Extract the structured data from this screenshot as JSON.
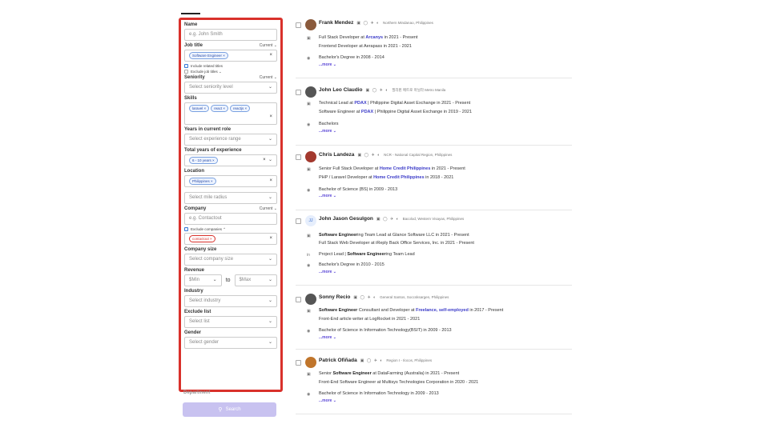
{
  "filters": {
    "name_label": "Name",
    "name_placeholder": "e.g. John Smith",
    "job_title_label": "Job title",
    "job_title_mode": "Current",
    "job_title_chip": "Software Engineer ×",
    "include_related": "Include related titles",
    "exclude_titles": "Exclude job titles ⌄",
    "seniority_label": "Seniority",
    "seniority_mode": "Current",
    "seniority_placeholder": "Select seniority level",
    "skills_label": "Skills",
    "skill_chips": [
      "laravel ×",
      "react ×",
      "reactjs ×"
    ],
    "years_role_label": "Years in current role",
    "years_role_placeholder": "Select experience range",
    "total_exp_label": "Total years of experience",
    "total_exp_chip": "6 - 10 years ×",
    "location_label": "Location",
    "location_chip": "Philippines ×",
    "mile_radius_placeholder": "Select mile radius",
    "company_label": "Company",
    "company_mode": "Current",
    "company_placeholder": "e.g. Contactout",
    "exclude_companies": "Exclude companies ⌃",
    "excluded_company_chip": "contactout ×",
    "company_size_label": "Company size",
    "company_size_placeholder": "Select company size",
    "revenue_label": "Revenue",
    "revenue_min": "$Min",
    "revenue_to": "to",
    "revenue_max": "$Max",
    "industry_label": "Industry",
    "industry_placeholder": "Select industry",
    "exclude_list_label": "Exclude list",
    "exclude_list_placeholder": "Select list",
    "gender_label": "Gender",
    "gender_placeholder": "Select gender",
    "department_label": "Department",
    "search_button": "Search"
  },
  "icons": {
    "clear": "×",
    "chevron": "⌄",
    "search": "search-icon",
    "socials": "▣ ◯ ✈ ◐"
  },
  "colors": {
    "panel_border": "#d9312b",
    "accent": "#3b3bc8",
    "search_button": "#c8c2f0"
  },
  "results": [
    {
      "name": "Frank Mendez",
      "location": "Northern Mindanao, Philippines",
      "exp1_pre": "Full Stack Developer at ",
      "exp1_company": "Arcanys",
      "exp1_post": " in 2021 - Present",
      "exp2": "Frontend Developer at Aerapass in 2021 - 2021",
      "edu": "Bachelor's Degree in 2008 - 2014",
      "more": "...more ⌄"
    },
    {
      "name": "John Leo Claudio",
      "location": "필리핀 메트로 마닐라 Metro Manila",
      "exp1_pre": "Technical Lead at ",
      "exp1_company": "PDAX",
      "exp1_post": " | Philippine Digital Asset Exchange in 2021 - Present",
      "exp2_pre": "Software Engineer at ",
      "exp2_company": "PDAX",
      "exp2_post": " | Philippine Digital Asset Exchange in 2019 - 2021",
      "edu": "Bachelors",
      "more": "...more ⌄"
    },
    {
      "name": "Chris Landeza",
      "location": "NCR - National Capital Region, Philippines",
      "exp1_pre": "Senior Full Stack Developer at ",
      "exp1_company": "Home Credit Philippines",
      "exp1_post": " in 2021 - Present",
      "exp2_pre": "PHP / Laravel Developer at ",
      "exp2_company": "Home Credit Philippines",
      "exp2_post": " in 2018 - 2021",
      "edu": "Bachelor of Science (BS) in 2009 - 2013",
      "more": "...more ⌄"
    },
    {
      "name": "John Jason Gesulgon",
      "initials": "JJ",
      "location": "Bacolod, Western Visayas, Philippines",
      "exp1_bold": "Software Engineer",
      "exp1_post": "ing Team Lead at Glance Software LLC in 2021 - Present",
      "exp2": "Full Stack Web Developer at iReply Back Office Services, Inc. in 2021 - Present",
      "exp3_pre": "Project Lead | ",
      "exp3_bold": "Software Engineer",
      "exp3_post": "ing Team Lead",
      "edu": "Bachelor's Degree in 2010 - 2015",
      "more": "...more ⌄"
    },
    {
      "name": "Sonny Recio",
      "location": "General Santos, Soccsksargen, Philippines",
      "exp1_bold": "Software Engineer",
      "exp1_mid": " Consultant and Developer at ",
      "exp1_company": "Freelance, self-employed",
      "exp1_post": " in 2017 - Present",
      "exp2": "Front-End article writer at LogRocket in 2021 - 2021",
      "edu": "Bachelor of Science in Information Technology(BSIT) in 2009 - 2013",
      "more": "...more ⌄"
    },
    {
      "name": "Patrick Ofiñada",
      "location": "Region I - Ilocos, Philippines",
      "exp1_pre": "Senior ",
      "exp1_bold": "Software Engineer",
      "exp1_post": " at DataFarming (Australia) in 2021 - Present",
      "exp2": "Front-End Software Engineer at Multisys Technologies Corporation in 2020 - 2021",
      "edu": "Bachelor of Science in Information Technology in 2009 - 2013",
      "more": "...more ⌄"
    }
  ]
}
